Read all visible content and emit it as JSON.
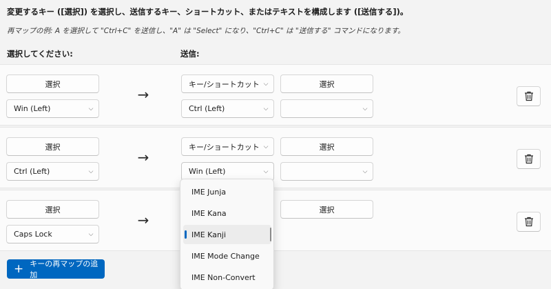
{
  "header": {
    "instruction": "変更するキー ([選択]) を選択し、送信するキー、ショートカット、またはテキストを構成します ([送信する])。",
    "example": "再マップの例: A を選択して \"Ctrl+C\" を送信し、\"A\" は \"Select\" になり、\"Ctrl+C\" は \"送信する\" コマンドになります。",
    "select_column": "選択してください:",
    "send_column": "送信:"
  },
  "rows": [
    {
      "select_button": "選択",
      "source_key": "Win (Left)",
      "send_type": "キー/ショートカットの送",
      "send_button": "選択",
      "target_key": "Ctrl (Left)",
      "text_value": "",
      "arrow": "→",
      "delete_icon": "trash-icon"
    },
    {
      "select_button": "選択",
      "source_key": "Ctrl (Left)",
      "send_type": "キー/ショートカットの送",
      "send_button": "選択",
      "target_key": "Win (Left)",
      "text_value": "",
      "arrow": "→",
      "delete_icon": "trash-icon"
    },
    {
      "select_button": "選択",
      "source_key": "Caps Lock",
      "send_button": "選択",
      "arrow": "→",
      "delete_icon": "trash-icon"
    }
  ],
  "dropdown": {
    "options": [
      "IME Junja",
      "IME Kana",
      "IME Kanji",
      "IME Mode Change",
      "IME Non-Convert"
    ],
    "selected": "IME Kanji"
  },
  "add_button": {
    "label": "キーの再マップの追加",
    "icon": "plus-icon"
  },
  "colors": {
    "accent": "#0067c0",
    "background": "#f3f3f3",
    "row": "#fbfbfb"
  }
}
